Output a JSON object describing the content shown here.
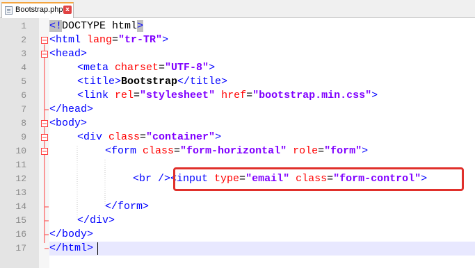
{
  "tab": {
    "filename": "Bootstrap.php",
    "close_glyph": "x"
  },
  "colors": {
    "tag": "#0000ff",
    "attribute": "#ff0000",
    "value": "#8000ff",
    "fold_line": "#ff3b3b",
    "callout": "#e0302b"
  },
  "line_numbers": [
    "1",
    "2",
    "3",
    "4",
    "5",
    "6",
    "7",
    "8",
    "9",
    "10",
    "11",
    "12",
    "13",
    "14",
    "15",
    "16",
    "17"
  ],
  "code": {
    "l1": {
      "open": "<!",
      "rest": "DOCTYPE html",
      "close": ">"
    },
    "l2": {
      "tag_open": "<html",
      "attr": " lang",
      "eq": "=",
      "val": "\"tr-TR\"",
      "tag_close": ">"
    },
    "l3": {
      "tag": "<head>"
    },
    "l4": {
      "tag_open": "<meta",
      "attr": " charset",
      "eq": "=",
      "val": "\"UTF-8\"",
      "tag_close": ">"
    },
    "l5": {
      "tag_open": "<title>",
      "text": "Bootstrap",
      "tag_close": "</title>"
    },
    "l6": {
      "tag_open": "<link",
      "attr1": " rel",
      "eq1": "=",
      "val1": "\"stylesheet\"",
      "attr2": " href",
      "eq2": "=",
      "val2": "\"bootstrap.min.css\"",
      "tag_close": ">"
    },
    "l7": {
      "tag": "</head>"
    },
    "l8": {
      "tag": "<body>"
    },
    "l9": {
      "tag_open": "<div",
      "attr": " class",
      "eq": "=",
      "val": "\"container\"",
      "tag_close": ">"
    },
    "l10": {
      "tag_open": "<form",
      "attr1": " class",
      "eq1": "=",
      "val1": "\"form-horizontal\"",
      "attr2": " role",
      "eq2": "=",
      "val2": "\"form\"",
      "tag_close": ">"
    },
    "l12": {
      "br": "<br />",
      "tag_open": "<input",
      "attr1": " type",
      "eq1": "=",
      "val1": "\"email\"",
      "attr2": " class",
      "eq2": "=",
      "val2": "\"form-control\"",
      "tag_close": ">"
    },
    "l14": {
      "tag": "</form>"
    },
    "l15": {
      "tag": "</div>"
    },
    "l16": {
      "tag": "</body>"
    },
    "l17": {
      "tag": "</html>"
    }
  }
}
